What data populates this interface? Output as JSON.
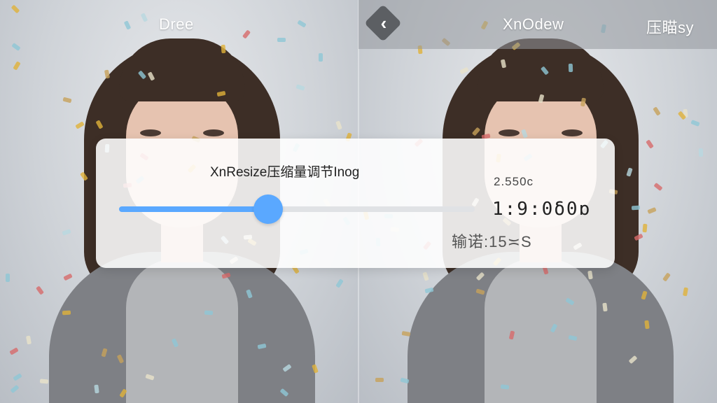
{
  "left_pane": {
    "title": "Dree"
  },
  "right_pane": {
    "title": "XnOdew",
    "action": "压瞄sy",
    "back_icon": "chevron-left-icon"
  },
  "panel": {
    "title": "XnResize压缩量调节Inog",
    "slider": {
      "value": 0.42
    },
    "size_label": "2.550c",
    "ratio_label": "1:9:0δ0ɒ",
    "output_label": "输诺:15≍S"
  },
  "colors": {
    "accent": "#5aa8ff",
    "panel_bg": "#ffffff",
    "hoodie": "#7e8085",
    "hair": "#3d2e26"
  }
}
